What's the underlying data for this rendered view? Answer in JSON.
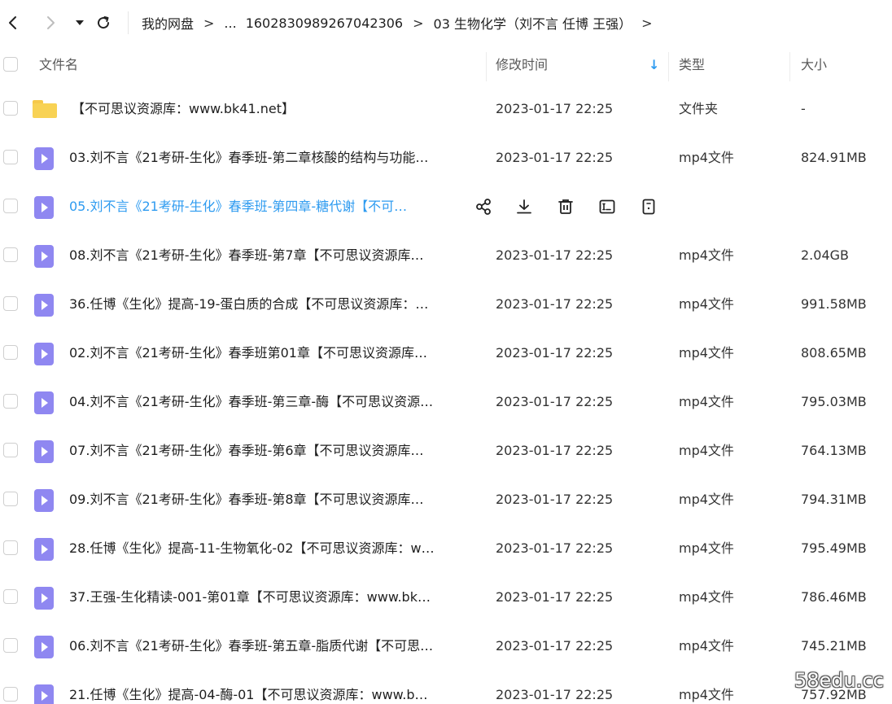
{
  "toolbar": {
    "icons": [
      "back-icon",
      "forward-icon",
      "dropdown-icon",
      "refresh-icon"
    ],
    "breadcrumb": [
      "我的网盘",
      "...",
      "1602830989267042306",
      "03 生物化学（刘不言 任博 王强）"
    ],
    "breadcrumb_separator": ">"
  },
  "header": {
    "name": "文件名",
    "time": "修改时间",
    "type": "类型",
    "size": "大小",
    "sort_indicator": "↓"
  },
  "colors": {
    "accent": "#2e9bf0",
    "video_icon": "#8f87f1",
    "folder_icon": "#f8d254"
  },
  "hover_actions": [
    "share-icon",
    "download-icon",
    "delete-icon",
    "rename-icon",
    "more-icon"
  ],
  "rows": [
    {
      "kind": "folder",
      "name": "【不可思议资源库：www.bk41.net】",
      "time": "2023-01-17 22:25",
      "type": "文件夹",
      "size": "-"
    },
    {
      "kind": "video",
      "name": "03.刘不言《21考研-生化》春季班-第二章核酸的结构与功能…",
      "time": "2023-01-17 22:25",
      "type": "mp4文件",
      "size": "824.91MB"
    },
    {
      "kind": "video",
      "hover": true,
      "name": "05.刘不言《21考研-生化》春季班-第四章-糖代谢【不可…",
      "time": "",
      "type": "",
      "size": ""
    },
    {
      "kind": "video",
      "name": "08.刘不言《21考研-生化》春季班-第7章【不可思议资源库…",
      "time": "2023-01-17 22:25",
      "type": "mp4文件",
      "size": "2.04GB"
    },
    {
      "kind": "video",
      "name": "36.任博《生化》提高-19-蛋白质的合成【不可思议资源库：…",
      "time": "2023-01-17 22:25",
      "type": "mp4文件",
      "size": "991.58MB"
    },
    {
      "kind": "video",
      "name": "02.刘不言《21考研-生化》春季班第01章【不可思议资源库…",
      "time": "2023-01-17 22:25",
      "type": "mp4文件",
      "size": "808.65MB"
    },
    {
      "kind": "video",
      "name": "04.刘不言《21考研-生化》春季班-第三章-酶【不可思议资源…",
      "time": "2023-01-17 22:25",
      "type": "mp4文件",
      "size": "795.03MB"
    },
    {
      "kind": "video",
      "name": "07.刘不言《21考研-生化》春季班-第6章【不可思议资源库…",
      "time": "2023-01-17 22:25",
      "type": "mp4文件",
      "size": "764.13MB"
    },
    {
      "kind": "video",
      "name": "09.刘不言《21考研-生化》春季班-第8章【不可思议资源库…",
      "time": "2023-01-17 22:25",
      "type": "mp4文件",
      "size": "794.31MB"
    },
    {
      "kind": "video",
      "name": "28.任博《生化》提高-11-生物氧化-02【不可思议资源库：w…",
      "time": "2023-01-17 22:25",
      "type": "mp4文件",
      "size": "795.49MB"
    },
    {
      "kind": "video",
      "name": "37.王强-生化精读-001-第01章【不可思议资源库：www.bk…",
      "time": "2023-01-17 22:25",
      "type": "mp4文件",
      "size": "786.46MB"
    },
    {
      "kind": "video",
      "name": "06.刘不言《21考研-生化》春季班-第五章-脂质代谢【不可思…",
      "time": "2023-01-17 22:25",
      "type": "mp4文件",
      "size": "745.21MB"
    },
    {
      "kind": "video",
      "name": "21.任博《生化》提高-04-酶-01【不可思议资源库：www.b…",
      "time": "2023-01-17 22:25",
      "type": "mp4文件",
      "size": "757.92MB"
    }
  ],
  "watermark": "58edu.cc"
}
